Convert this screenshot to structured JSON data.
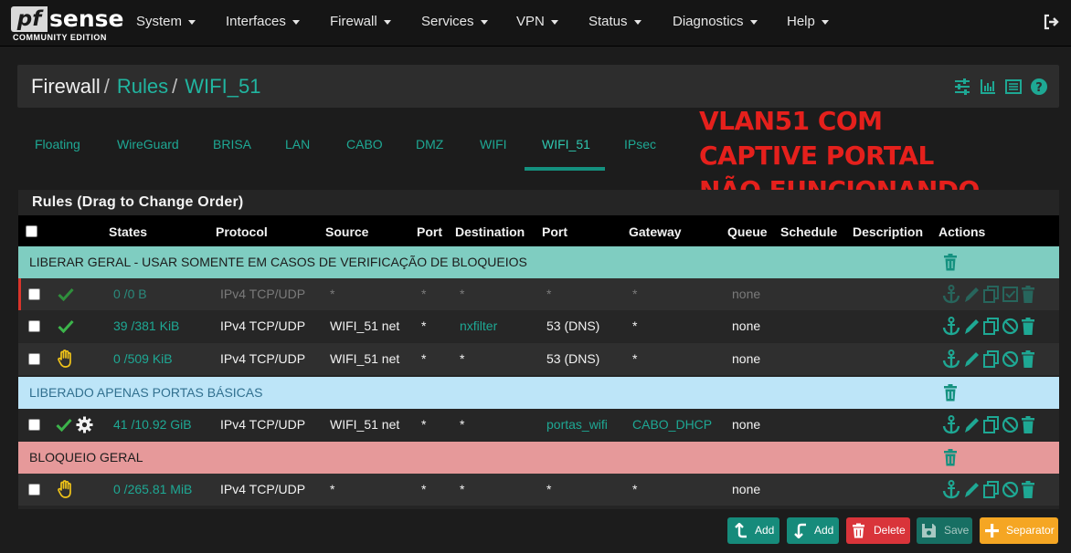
{
  "brand": {
    "logo_main": "sense",
    "logo_pf": "pf",
    "logo_sub": "COMMUNITY EDITION"
  },
  "nav": [
    "System",
    "Interfaces",
    "Firewall",
    "Services",
    "VPN",
    "Status",
    "Diagnostics",
    "Help"
  ],
  "breadcrumb": {
    "first": "Firewall",
    "second": "Rules",
    "third": "WIFI_51",
    "separator": "/"
  },
  "tabs": [
    "Floating",
    "WireGuard",
    "BRISA",
    "LAN",
    "CABO",
    "DMZ",
    "WIFI",
    "WIFI_51",
    "IPsec"
  ],
  "active_tab": "WIFI_51",
  "annotation": {
    "line1": "VLAN51 COM",
    "line2": "CAPTIVE PORTAL",
    "line3": "NÃO FUNCIONANDO"
  },
  "panel_title": "Rules (Drag to Change Order)",
  "columns": {
    "states": "States",
    "protocol": "Protocol",
    "source": "Source",
    "port": "Port",
    "destination": "Destination",
    "port2": "Port",
    "gateway": "Gateway",
    "queue": "Queue",
    "schedule": "Schedule",
    "description": "Description",
    "actions": "Actions"
  },
  "separators": {
    "s1": "LIBERAR GERAL - USAR SOMENTE EM CASOS DE VERIFICAÇÃO DE BLOQUEIOS",
    "s2": "LIBERADO APENAS PORTAS BÁSICAS",
    "s3": "BLOQUEIO GERAL"
  },
  "rules": [
    {
      "states": "0 /0 B",
      "protocol": "IPv4 TCP/UDP",
      "source": "*",
      "sport": "*",
      "destination": "*",
      "dport": "*",
      "gateway": "*",
      "queue": "none",
      "status": "pass",
      "disabled": true
    },
    {
      "states": "39 /381 KiB",
      "protocol": "IPv4 TCP/UDP",
      "source": "WIFI_51 net",
      "sport": "*",
      "destination": "nxfilter",
      "dport": "53 (DNS)",
      "gateway": "*",
      "queue": "none",
      "status": "pass",
      "disabled": false
    },
    {
      "states": "0 /509 KiB",
      "protocol": "IPv4 TCP/UDP",
      "source": "WIFI_51 net",
      "sport": "*",
      "destination": "*",
      "dport": "53 (DNS)",
      "gateway": "*",
      "queue": "none",
      "status": "block",
      "disabled": false
    },
    {
      "states": "41 /10.92 GiB",
      "protocol": "IPv4 TCP/UDP",
      "source": "WIFI_51 net",
      "sport": "*",
      "destination": "*",
      "dport": "portas_wifi",
      "gateway": "CABO_DHCP",
      "queue": "none",
      "status": "pass",
      "disabled": false
    },
    {
      "states": "0 /265.81 MiB",
      "protocol": "IPv4 TCP/UDP",
      "source": "*",
      "sport": "*",
      "destination": "*",
      "dport": "*",
      "gateway": "*",
      "queue": "none",
      "status": "block",
      "disabled": false
    }
  ],
  "buttons": {
    "add_top": "Add",
    "add_bottom": "Add",
    "delete": "Delete",
    "save": "Save",
    "separator": "Separator"
  },
  "colors": {
    "teal": "#1ea894",
    "pass": "#3cb44b",
    "block": "#f0c419",
    "danger": "#d9343a",
    "accent": "#f5a623",
    "annotation": "#e5201c"
  }
}
